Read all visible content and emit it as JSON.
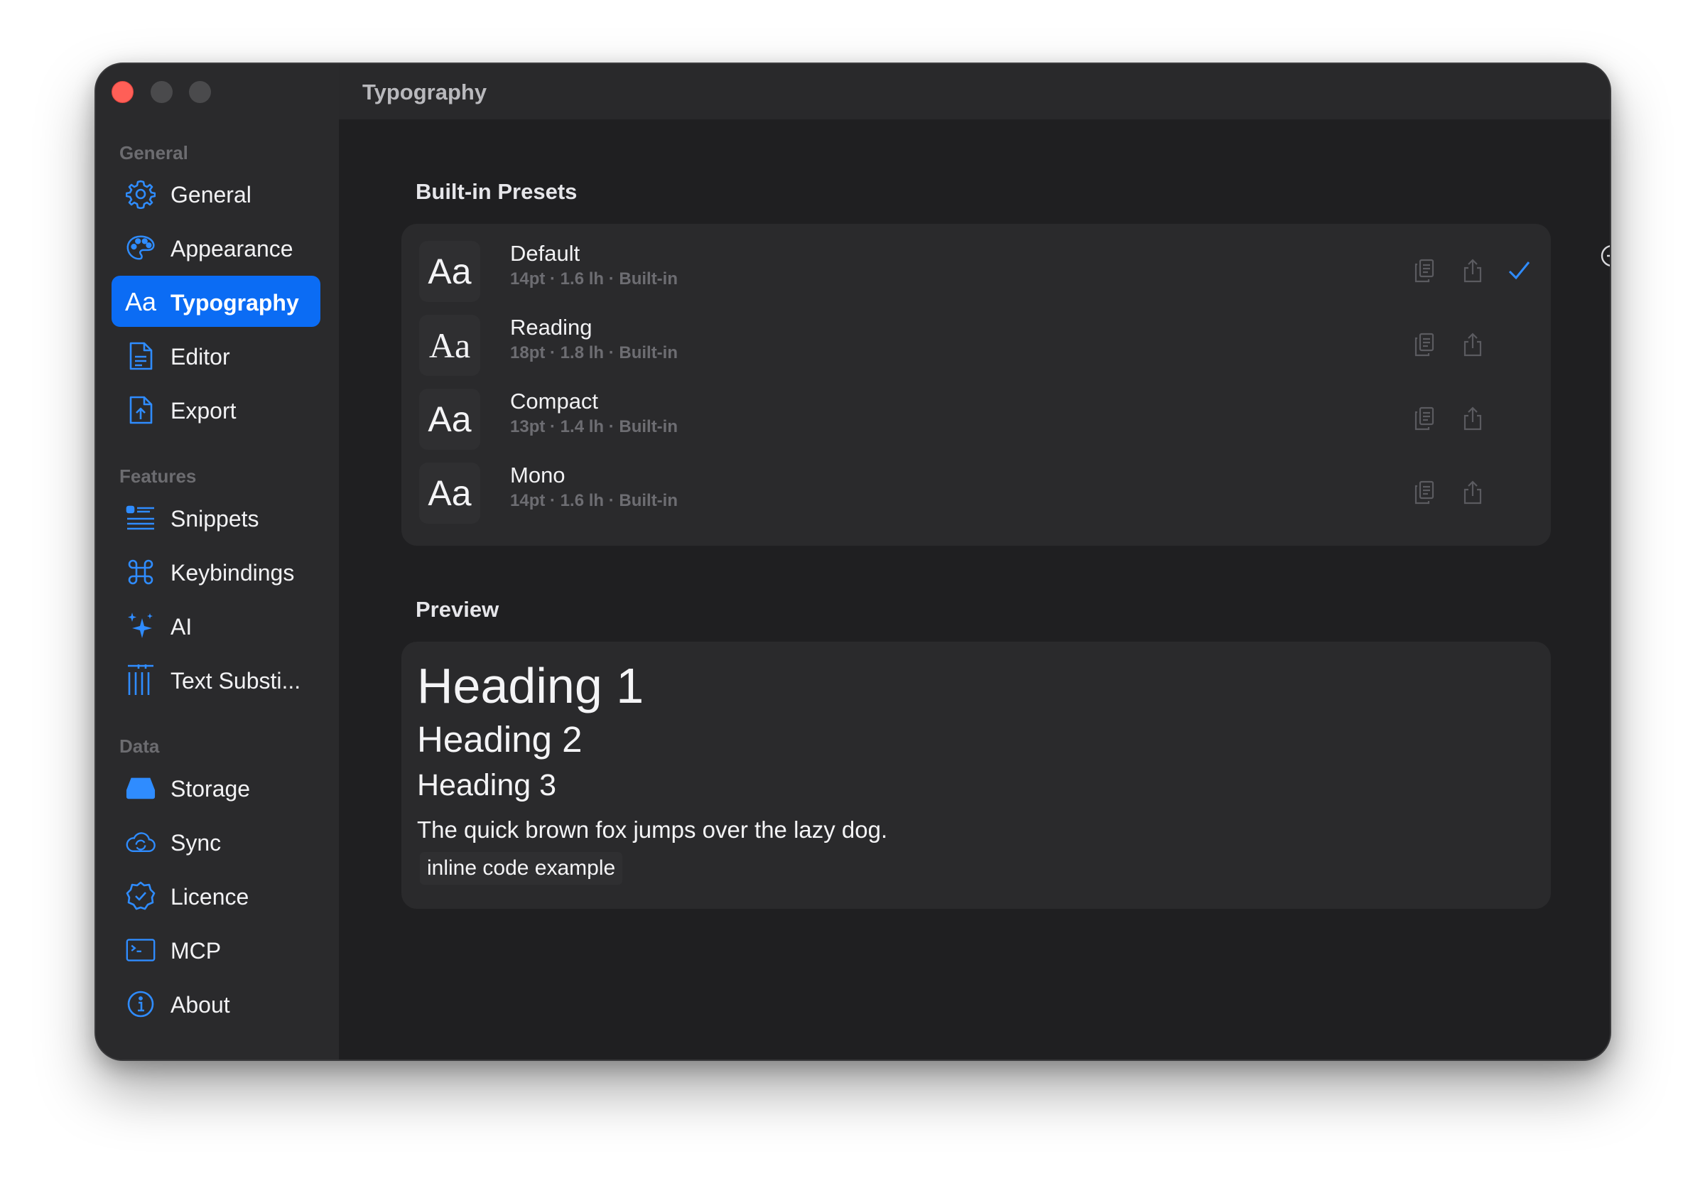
{
  "window": {
    "title": "Typography"
  },
  "sidebar": {
    "sections": [
      {
        "label": "General"
      },
      {
        "label": "Features"
      },
      {
        "label": "Data"
      }
    ],
    "items": [
      {
        "label": "General",
        "icon": "gear-icon"
      },
      {
        "label": "Appearance",
        "icon": "palette-icon"
      },
      {
        "label": "Typography",
        "icon": "aa-icon",
        "active": true
      },
      {
        "label": "Editor",
        "icon": "document-icon"
      },
      {
        "label": "Export",
        "icon": "export-document-icon"
      },
      {
        "label": "Snippets",
        "icon": "list-icon"
      },
      {
        "label": "Keybindings",
        "icon": "command-icon"
      },
      {
        "label": "AI",
        "icon": "sparkles-icon"
      },
      {
        "label": "Text Substi...",
        "icon": "text-substitution-icon"
      },
      {
        "label": "Storage",
        "icon": "drive-icon"
      },
      {
        "label": "Sync",
        "icon": "cloud-sync-icon"
      },
      {
        "label": "Licence",
        "icon": "checkmark-seal-icon"
      },
      {
        "label": "MCP",
        "icon": "terminal-icon"
      },
      {
        "label": "About",
        "icon": "info-icon"
      }
    ]
  },
  "presets": {
    "heading": "Built-in Presets",
    "add_icon": "plus-circle-icon",
    "items": [
      {
        "preview": "Aa",
        "name": "Default",
        "meta": "14pt · 1.6 lh · Built-in",
        "selected": true
      },
      {
        "preview": "Aa",
        "name": "Reading",
        "meta": "18pt · 1.8 lh · Built-in",
        "selected": false
      },
      {
        "preview": "Aa",
        "name": "Compact",
        "meta": "13pt · 1.4 lh · Built-in",
        "selected": false
      },
      {
        "preview": "Aa",
        "name": "Mono",
        "meta": "14pt · 1.6 lh · Built-in",
        "selected": false
      }
    ]
  },
  "preview": {
    "heading": "Preview",
    "h1": "Heading 1",
    "h2": "Heading 2",
    "h3": "Heading 3",
    "paragraph": "The quick brown fox jumps over the lazy dog.",
    "code": "inline code example"
  },
  "colors": {
    "accent": "#0b6cf4",
    "icon_blue": "#2f8cff",
    "close_red": "#ff5f57"
  }
}
